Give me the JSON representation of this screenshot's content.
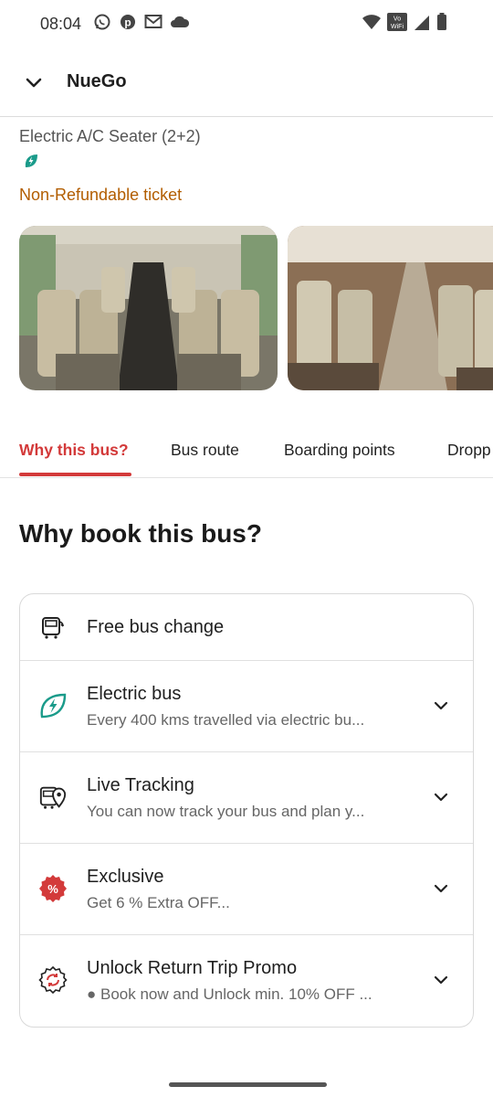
{
  "status_bar": {
    "time": "08:04",
    "wifi_badge": "Vo WiFi"
  },
  "header": {
    "title": "NueGo"
  },
  "trip": {
    "bus_type": "Electric A/C Seater (2+2)",
    "refund_policy": "Non-Refundable ticket"
  },
  "tabs": [
    {
      "label": "Why this bus?"
    },
    {
      "label": "Bus route"
    },
    {
      "label": "Boarding points"
    },
    {
      "label": "Dropp"
    }
  ],
  "section_title": "Why book this bus?",
  "features": [
    {
      "title": "Free bus change",
      "subtitle": "",
      "icon": "bus-change-icon"
    },
    {
      "title": "Electric bus",
      "subtitle": "Every 400 kms travelled via electric bu...",
      "icon": "leaf-bolt-icon"
    },
    {
      "title": "Live Tracking",
      "subtitle": "You can now track your bus and plan y...",
      "icon": "bus-location-icon"
    },
    {
      "title": "Exclusive",
      "subtitle": "Get 6 % Extra OFF...",
      "icon": "percent-badge-icon"
    },
    {
      "title": "Unlock Return Trip Promo",
      "subtitle": "● Book now and Unlock min. 10% OFF ...",
      "icon": "return-promo-icon"
    }
  ],
  "colors": {
    "accent": "#d33a3a",
    "refund": "#b25d00",
    "electric": "#1a9b8a"
  }
}
